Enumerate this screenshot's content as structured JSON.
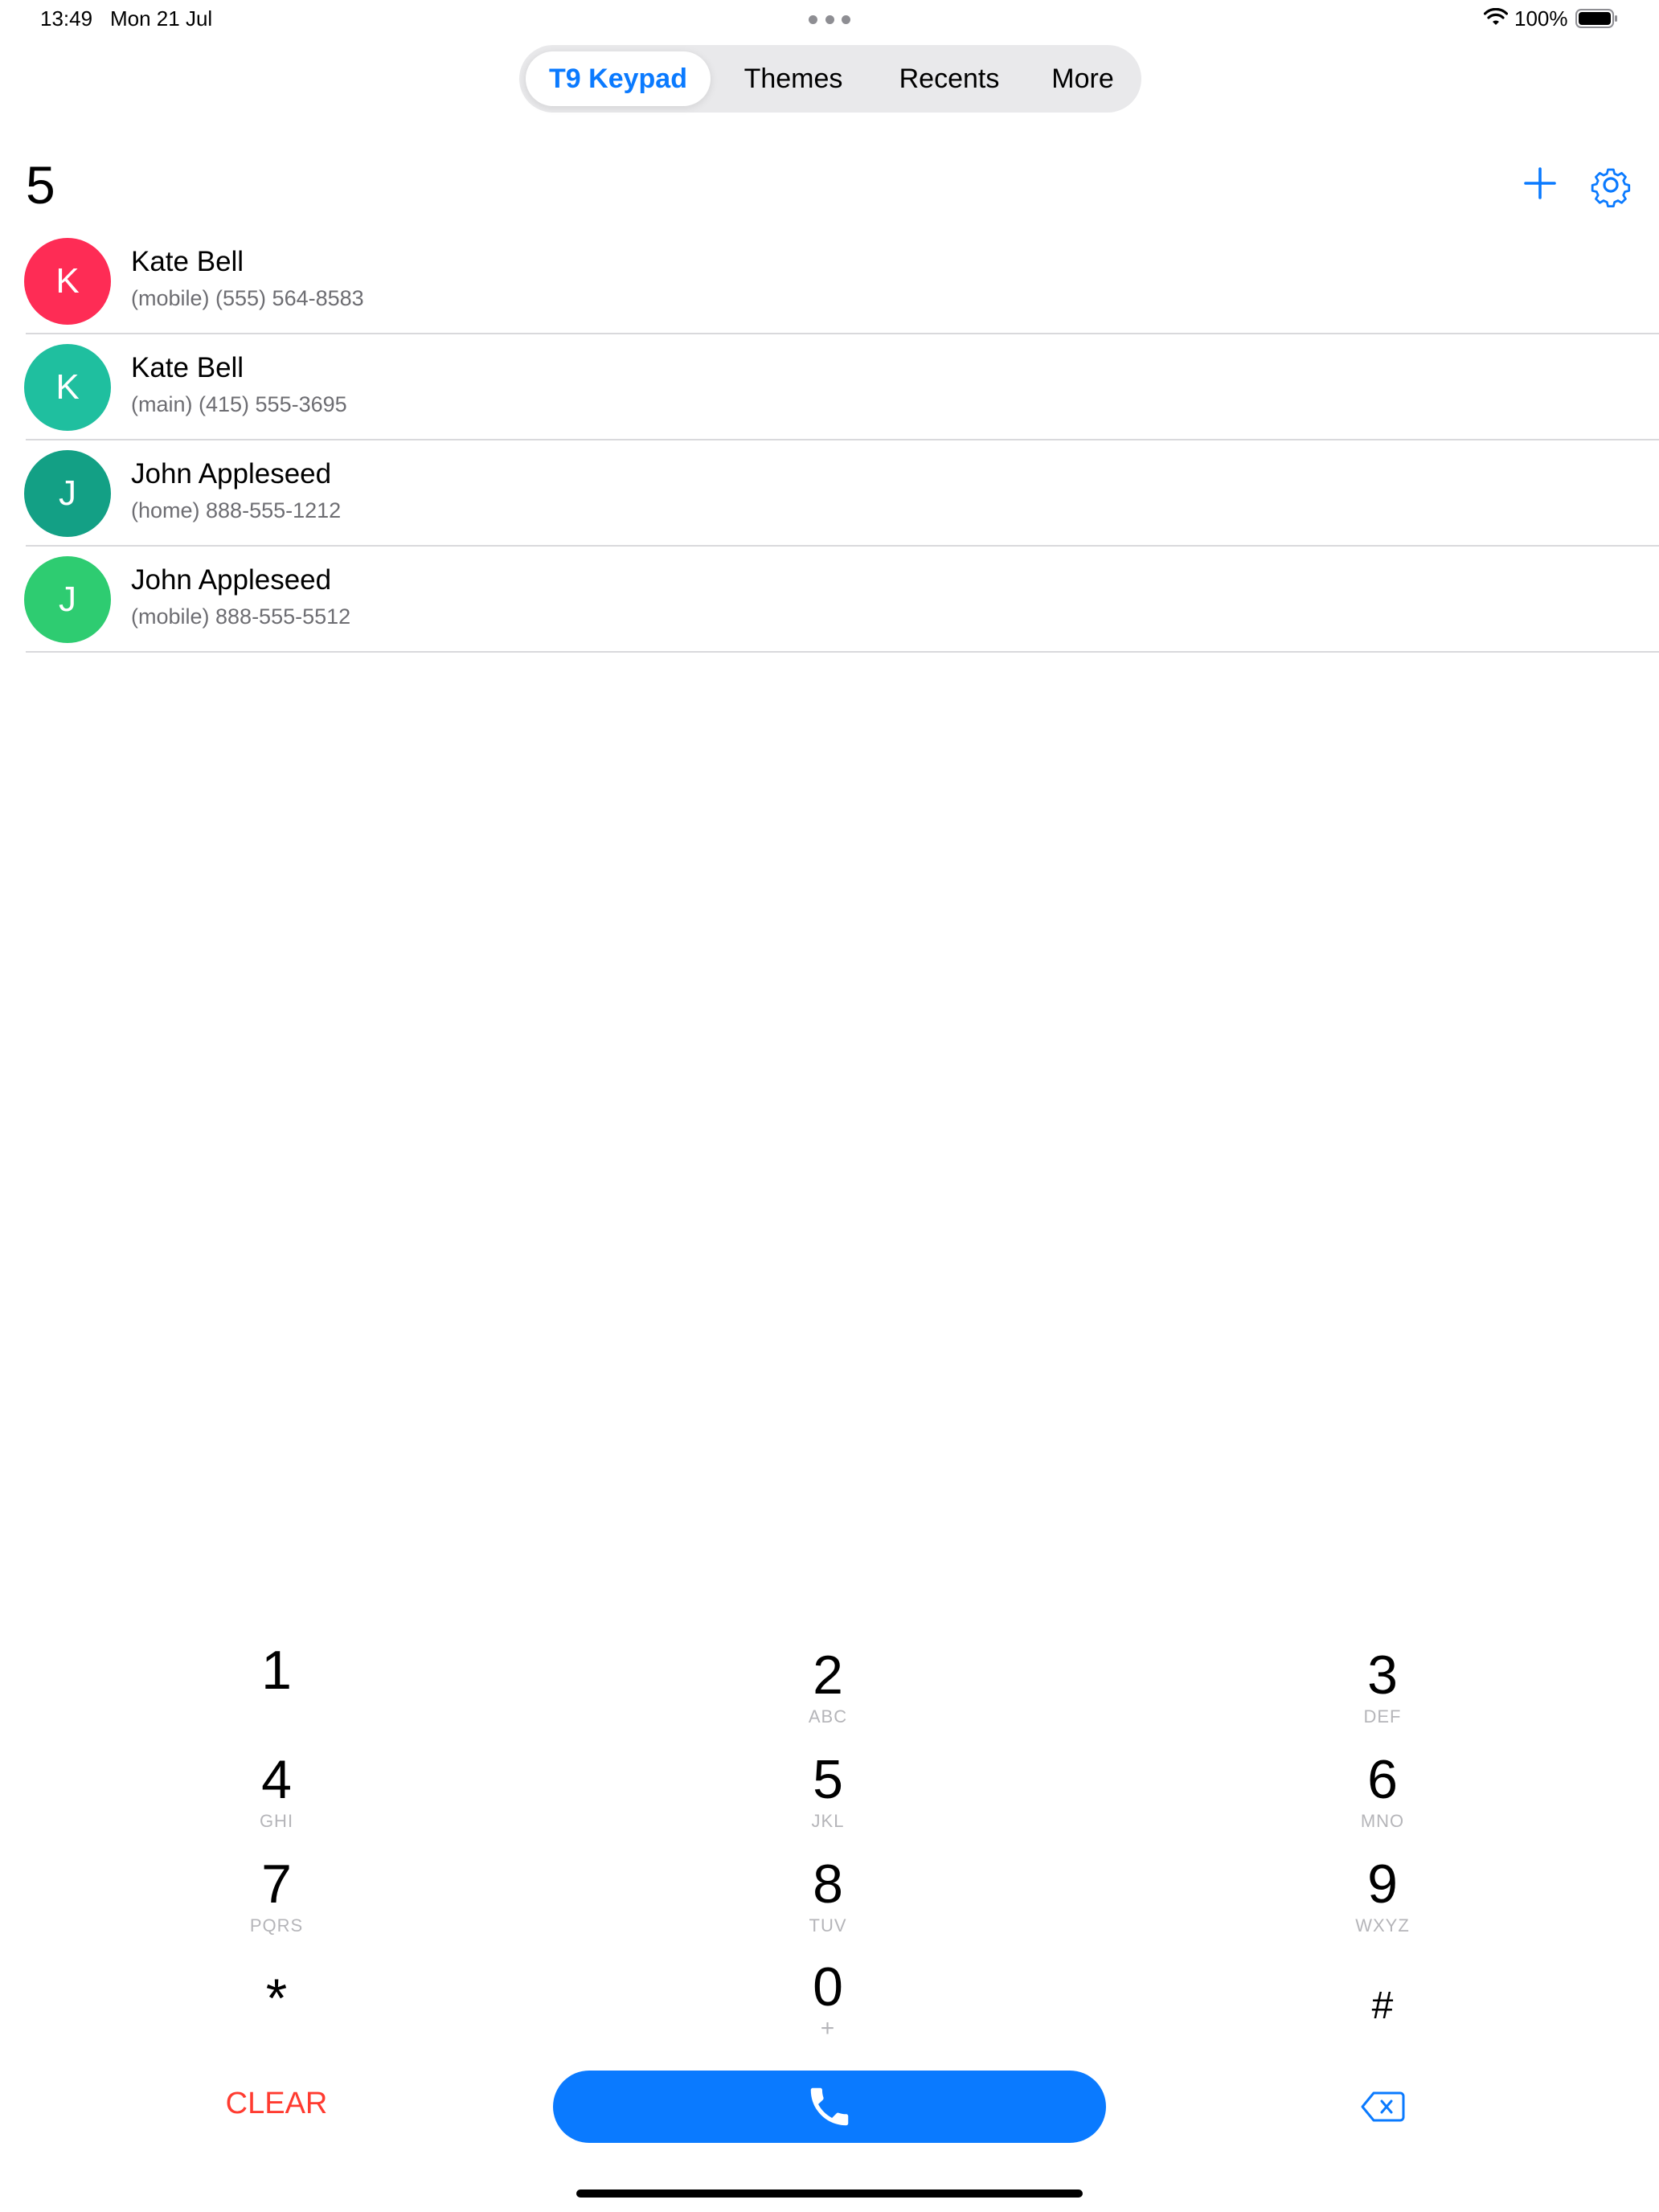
{
  "status_bar": {
    "time": "13:49",
    "date": "Mon 21 Jul",
    "battery": "100%"
  },
  "tabs": [
    {
      "label": "T9 Keypad",
      "active": true
    },
    {
      "label": "Themes",
      "active": false
    },
    {
      "label": "Recents",
      "active": false
    },
    {
      "label": "More",
      "active": false
    }
  ],
  "dialed_number": "5",
  "contacts": [
    {
      "initial": "K",
      "name": "Kate Bell",
      "phone": "(mobile) (555) 564-8583",
      "color": "#fe2c55"
    },
    {
      "initial": "K",
      "name": "Kate Bell",
      "phone": "(main) (415) 555-3695",
      "color": "#1fbf9f"
    },
    {
      "initial": "J",
      "name": "John Appleseed",
      "phone": "(home) 888-555-1212",
      "color": "#13a085"
    },
    {
      "initial": "J",
      "name": "John Appleseed",
      "phone": "(mobile) 888-555-5512",
      "color": "#2ecc71"
    }
  ],
  "keypad": [
    {
      "digit": "1",
      "letters": ""
    },
    {
      "digit": "2",
      "letters": "ABC"
    },
    {
      "digit": "3",
      "letters": "DEF"
    },
    {
      "digit": "4",
      "letters": "GHI"
    },
    {
      "digit": "5",
      "letters": "JKL"
    },
    {
      "digit": "6",
      "letters": "MNO"
    },
    {
      "digit": "7",
      "letters": "PQRS"
    },
    {
      "digit": "8",
      "letters": "TUV"
    },
    {
      "digit": "9",
      "letters": "WXYZ"
    },
    {
      "digit": "*",
      "letters": ""
    },
    {
      "digit": "0",
      "letters": "+"
    },
    {
      "digit": "#",
      "letters": ""
    }
  ],
  "actions": {
    "clear_label": "CLEAR",
    "call_icon": "phone-icon",
    "backspace_icon": "backspace-icon",
    "add_icon": "plus-icon",
    "settings_icon": "gear-icon"
  },
  "colors": {
    "accent": "#0a7aff",
    "clear": "#ff3b30"
  }
}
